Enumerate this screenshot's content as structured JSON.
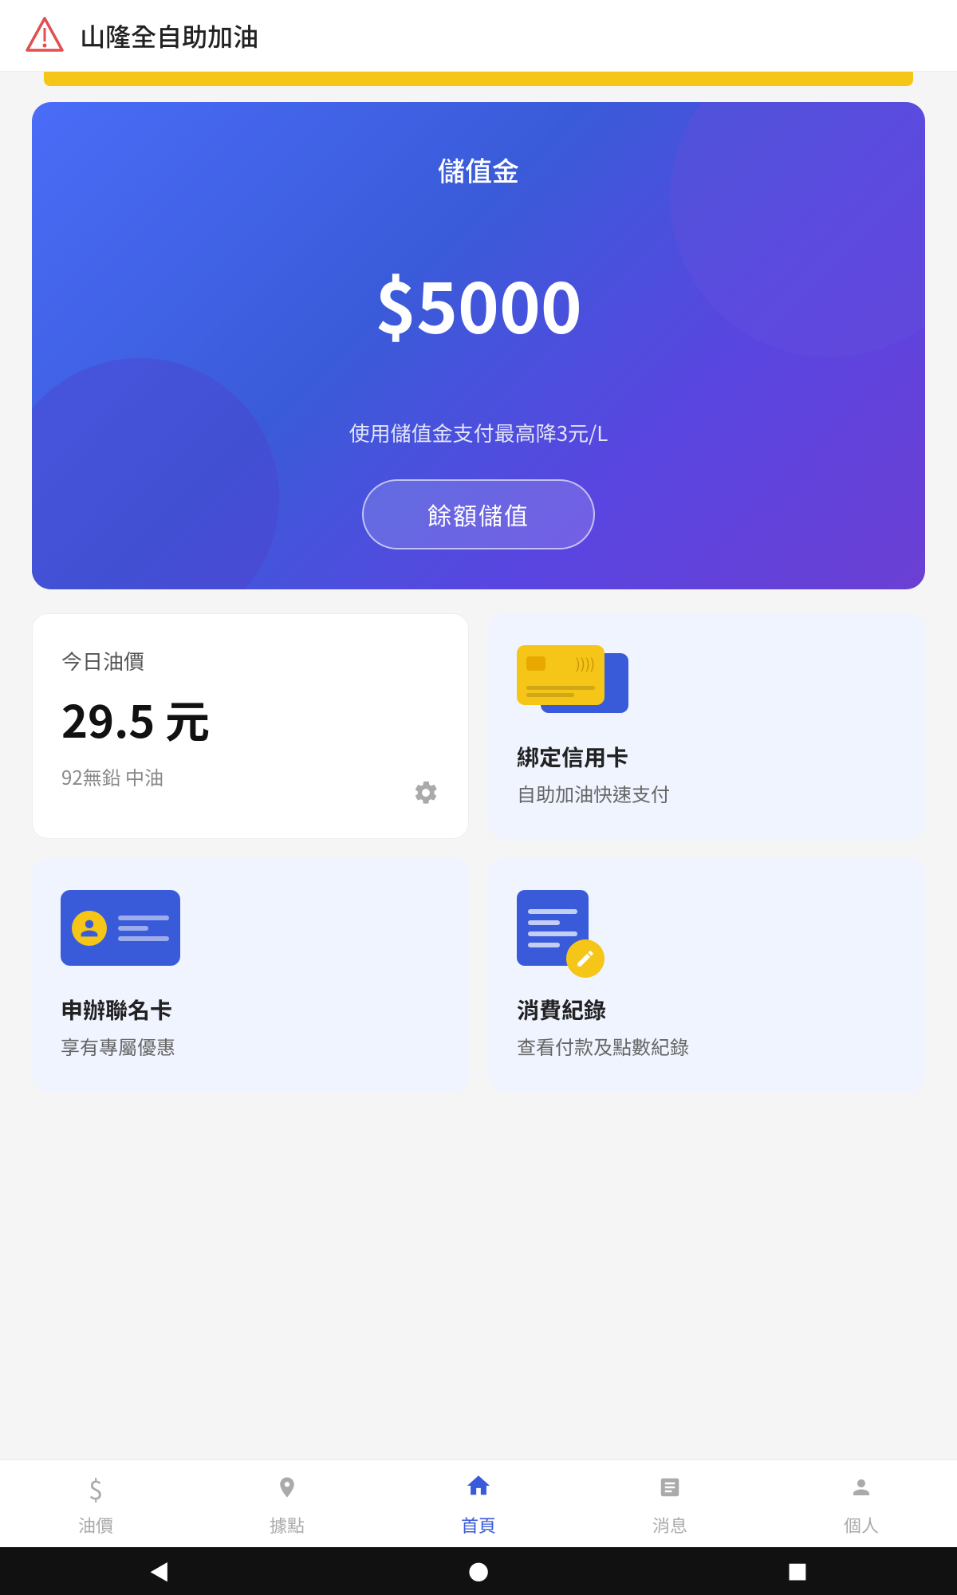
{
  "header": {
    "title": "山隆全自助加油",
    "logo_alt": "ShanLong Logo"
  },
  "balance_card": {
    "label": "儲值金",
    "amount": "$5000",
    "description": "使用儲值金支付最高降3元/L",
    "button_label": "餘額儲值"
  },
  "oil_price_card": {
    "section_label": "今日油價",
    "price": "29.5 元",
    "type": "92無鉛 中油"
  },
  "credit_card_section": {
    "title": "綁定信用卡",
    "subtitle": "自助加油快速支付"
  },
  "membership_card_section": {
    "title": "申辦聯名卡",
    "subtitle": "享有專屬優惠"
  },
  "consumption_record_section": {
    "title": "消費紀錄",
    "subtitle": "查看付款及點數紀錄"
  },
  "bottom_nav": {
    "items": [
      {
        "label": "油價",
        "icon": "💲",
        "active": false
      },
      {
        "label": "據點",
        "icon": "📍",
        "active": false
      },
      {
        "label": "首頁",
        "icon": "🏠",
        "active": true
      },
      {
        "label": "消息",
        "icon": "📋",
        "active": false
      },
      {
        "label": "個人",
        "icon": "👤",
        "active": false
      }
    ]
  },
  "system_bar": {
    "back": "◀",
    "home": "●",
    "recent": "■"
  }
}
